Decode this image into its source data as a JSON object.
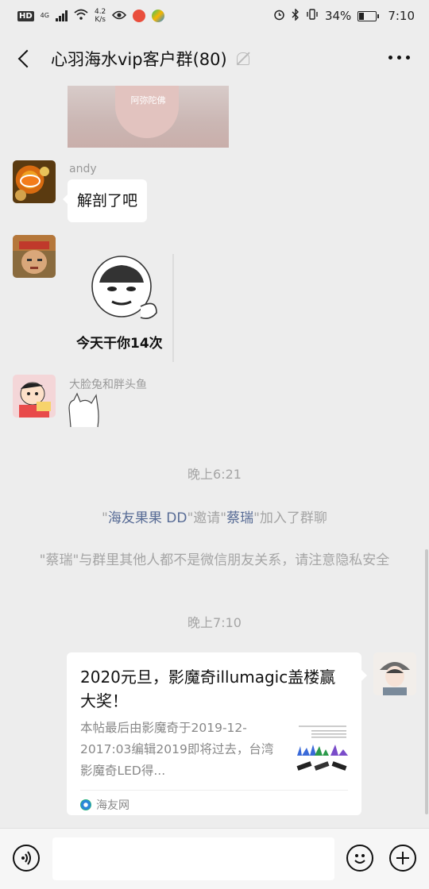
{
  "status_bar": {
    "hd": "HD",
    "network": "4G",
    "speed_value": "4.2",
    "speed_unit": "K/s",
    "battery": "34%",
    "time": "7:10",
    "battery_level": 0.34
  },
  "header": {
    "title": "心羽海水vip客户群(80)"
  },
  "chat": {
    "photo_caption": "阿弥陀佛",
    "messages": [
      {
        "sender": "andy",
        "text": "解剖了吧"
      },
      {
        "sender": "",
        "sticker_caption": "今天干你14次"
      },
      {
        "sender": "大脸兔和胖头鱼"
      }
    ],
    "time1": "晚上6:21",
    "invite": {
      "inviter": "海友果果 DD",
      "q1": "\"",
      "q2": "\"邀请\"",
      "invitee": "蔡瑞",
      "q3": "\"加入了群聊"
    },
    "privacy_notice": "\"蔡瑞\"与群里其他人都不是微信朋友关系，请注意隐私安全",
    "time2": "晚上7:10",
    "card": {
      "title": "2020元旦，影魔奇illumagic盖楼赢大奖！",
      "description": "本帖最后由影魔奇于2019-12-2017:03编辑2019即将过去，台湾影魔奇LED得...",
      "source": "海友网"
    }
  },
  "icons": {
    "voice": "voice-icon",
    "emoji": "emoji-icon",
    "plus": "plus-icon"
  },
  "colors": {
    "background": "#ededed",
    "link": "#576b95",
    "system_text": "#a5a5a5"
  }
}
